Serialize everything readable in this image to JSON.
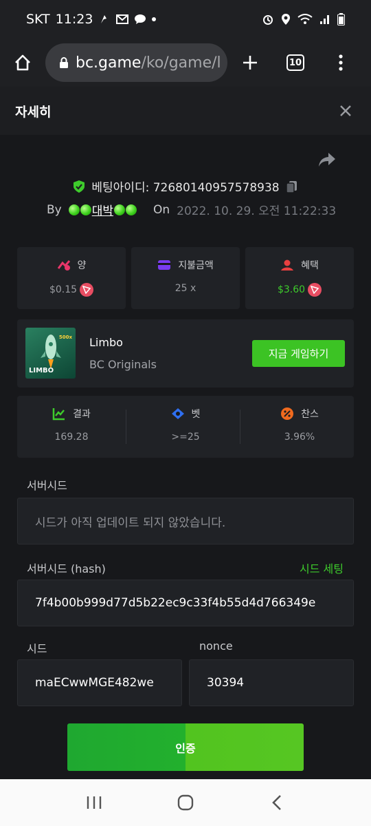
{
  "status_bar": {
    "carrier": "SKT",
    "time": "11:23"
  },
  "browser": {
    "url_host": "bc.game",
    "url_path": "/ko/game/l",
    "tab_count": "10"
  },
  "detail": {
    "title": "자세히",
    "bet_id_label": "베팅아이디: 72680140957578938",
    "by_label": "By",
    "username": "대박",
    "on_label": "On",
    "timestamp": "2022. 10. 29. 오전 11:22:33"
  },
  "stats": [
    {
      "label": "양",
      "value": "$0.15",
      "icon": "bet-amount-icon"
    },
    {
      "label": "지불금액",
      "value": "25 x",
      "icon": "wallet-icon"
    },
    {
      "label": "혜택",
      "value": "$3.60",
      "icon": "profit-icon"
    }
  ],
  "game": {
    "name": "Limbo",
    "provider": "BC Originals",
    "play_label": "지금 게임하기",
    "thumb_label": "LIMBO",
    "thumb_mult": "500x"
  },
  "results": [
    {
      "label": "결과",
      "value": "169.28",
      "icon": "chart-icon"
    },
    {
      "label": "벳",
      "value": ">=25",
      "icon": "target-icon"
    },
    {
      "label": "찬스",
      "value": "3.96%",
      "icon": "percent-icon"
    }
  ],
  "form": {
    "server_seed_label": "서버시드",
    "server_seed_placeholder": "시드가 아직 업데이트 되지 않았습니다.",
    "server_seed_hash_label": "서버시드 (hash)",
    "seed_settings_label": "시드 세팅",
    "server_seed_hash_value": "7f4b00b999d77d5b22ec9c33f4b55d4d766349e",
    "client_seed_label": "시드",
    "client_seed_value": "maECwwMGE482we",
    "nonce_label": "nonce",
    "nonce_value": "30394",
    "verify_label": "인증"
  },
  "colors": {
    "accent_green": "#3cc324",
    "bet_icon": "#e8366a",
    "wallet_icon": "#7a3cf0",
    "profit_icon": "#e84040",
    "percent_icon": "#f06a1e",
    "target_icon": "#2f6ff0"
  }
}
